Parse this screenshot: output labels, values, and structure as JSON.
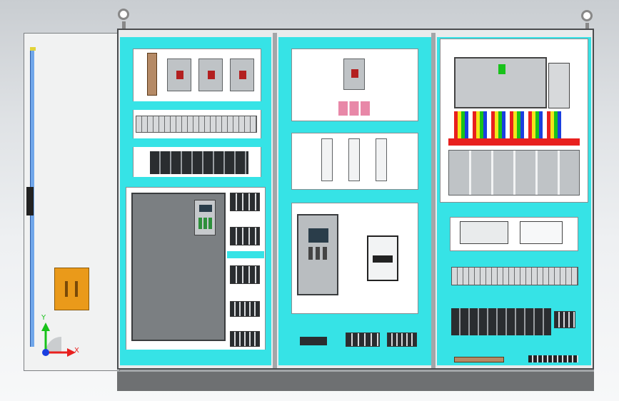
{
  "viewport": {
    "triad": {
      "x_label": "X",
      "y_label": "Y",
      "x_color": "#e8201e",
      "y_color": "#18c21a",
      "z_color": "#1a3fe0"
    }
  },
  "cabinet": {
    "frame_color": "#e9ebec",
    "trim_color": "#36e3e6",
    "base_color": "#6e7072",
    "lifting_eye_count": 2,
    "sections": [
      "left-section",
      "middle-section",
      "right-section"
    ],
    "plc_arrow_color": "#18c21a",
    "wire_colors": [
      "#e8201e",
      "#f2e51a",
      "#18c21a",
      "#1a3fe0"
    ]
  }
}
